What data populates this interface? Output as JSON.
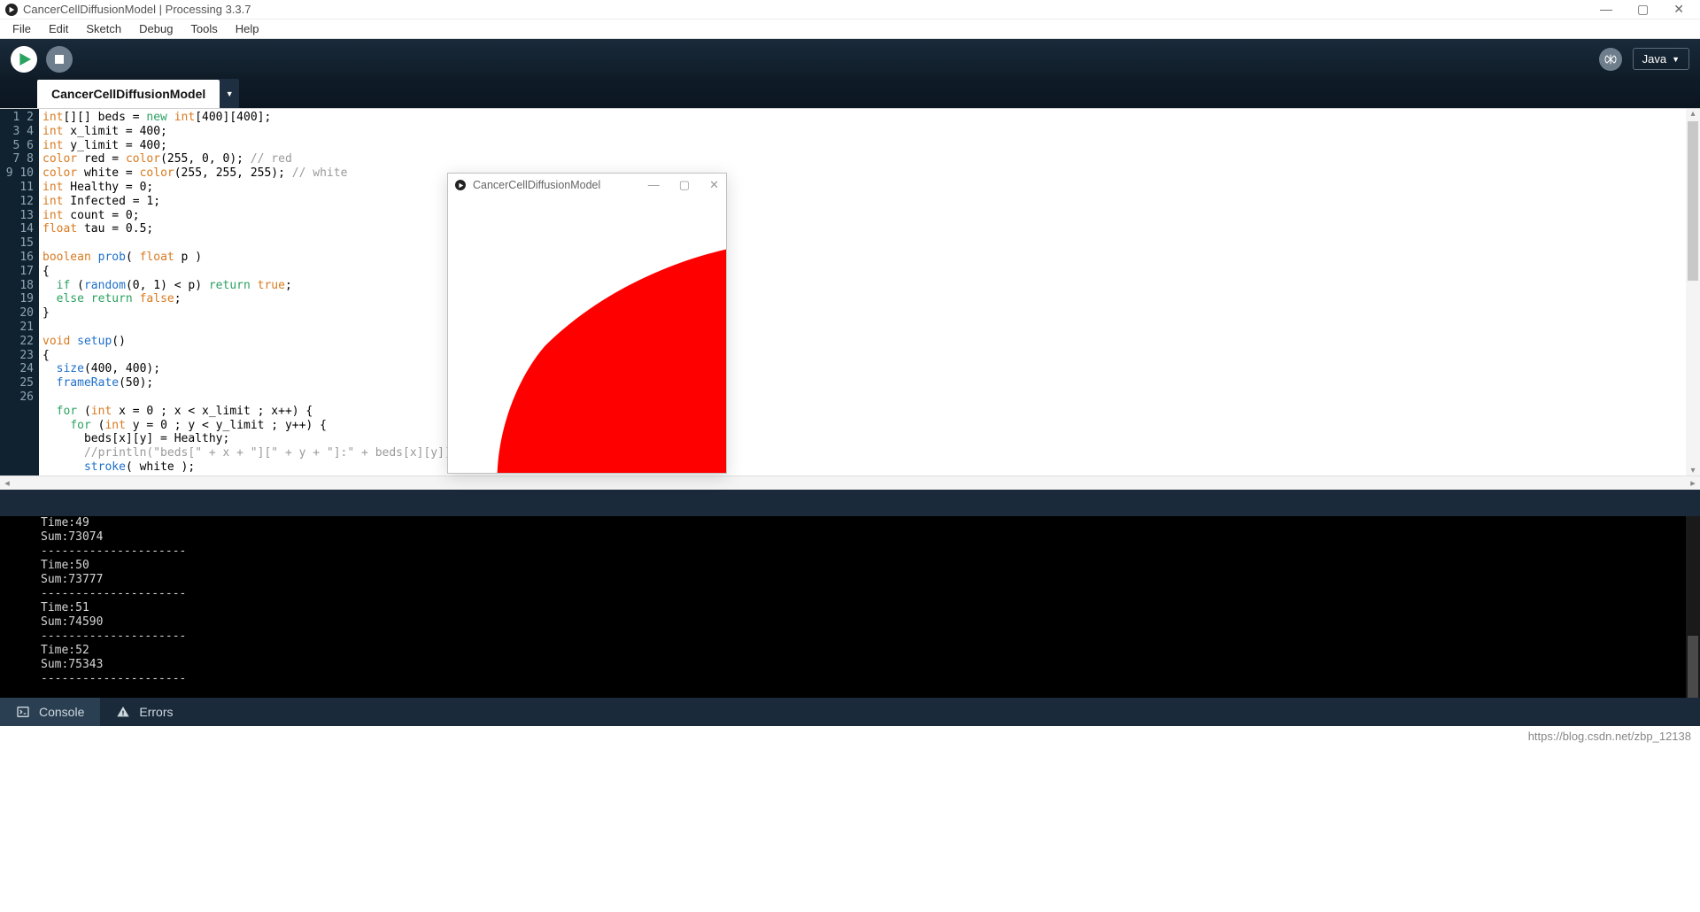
{
  "window": {
    "title": "CancerCellDiffusionModel | Processing 3.3.7"
  },
  "menubar": [
    "File",
    "Edit",
    "Sketch",
    "Debug",
    "Tools",
    "Help"
  ],
  "toolbar": {
    "mode_label": "Java"
  },
  "tabs": {
    "active": "CancerCellDiffusionModel"
  },
  "editor": {
    "first_line_no": 1,
    "last_line_no": 26,
    "lines": [
      {
        "n": 1,
        "tokens": [
          [
            "ty",
            "int"
          ],
          [
            "",
            "[][] beds = "
          ],
          [
            "kw",
            "new"
          ],
          [
            "",
            ""
          ],
          [
            "",
            ""
          ],
          [
            "",
            ""
          ],
          [
            "",
            ""
          ],
          [
            "",
            ""
          ],
          [
            "",
            ""
          ],
          [
            "",
            ""
          ],
          [
            "",
            ""
          ],
          [
            "",
            ""
          ]
        ],
        "raw": "int[][] beds = new int[400][400];"
      },
      {
        "n": 2,
        "raw": "int x_limit = 400;"
      },
      {
        "n": 3,
        "raw": "int y_limit = 400;"
      },
      {
        "n": 4,
        "raw": "color red = color(255, 0, 0); // red"
      },
      {
        "n": 5,
        "raw": "color white = color(255, 255, 255); // white"
      },
      {
        "n": 6,
        "raw": "int Healthy = 0;"
      },
      {
        "n": 7,
        "raw": "int Infected = 1;"
      },
      {
        "n": 8,
        "raw": "int count = 0;"
      },
      {
        "n": 9,
        "raw": "float tau = 0.5;"
      },
      {
        "n": 10,
        "raw": ""
      },
      {
        "n": 11,
        "raw": "boolean prob( float p )"
      },
      {
        "n": 12,
        "raw": "{"
      },
      {
        "n": 13,
        "raw": "  if (random(0, 1) < p) return true;"
      },
      {
        "n": 14,
        "raw": "  else return false;"
      },
      {
        "n": 15,
        "raw": "}"
      },
      {
        "n": 16,
        "raw": ""
      },
      {
        "n": 17,
        "raw": "void setup()"
      },
      {
        "n": 18,
        "raw": "{"
      },
      {
        "n": 19,
        "raw": "  size(400, 400);"
      },
      {
        "n": 20,
        "raw": "  frameRate(50);"
      },
      {
        "n": 21,
        "raw": ""
      },
      {
        "n": 22,
        "raw": "  for (int x = 0 ; x < x_limit ; x++) {"
      },
      {
        "n": 23,
        "raw": "    for (int y = 0 ; y < y_limit ; y++) {"
      },
      {
        "n": 24,
        "raw": "      beds[x][y] = Healthy;"
      },
      {
        "n": 25,
        "raw": "      //println(\"beds[\" + x + \"][\" + y + \"]:\" + beds[x][y]);"
      },
      {
        "n": 26,
        "raw": "      stroke( white );"
      }
    ]
  },
  "sketch_window": {
    "title": "CancerCellDiffusionModel"
  },
  "console": {
    "lines": [
      "Time:49",
      "Sum:73074",
      "---------------------",
      "Time:50",
      "Sum:73777",
      "---------------------",
      "Time:51",
      "Sum:74590",
      "---------------------",
      "Time:52",
      "Sum:75343",
      "---------------------"
    ]
  },
  "status_tabs": {
    "console": "Console",
    "errors": "Errors"
  },
  "footer": {
    "url": "https://blog.csdn.net/zbp_12138"
  }
}
